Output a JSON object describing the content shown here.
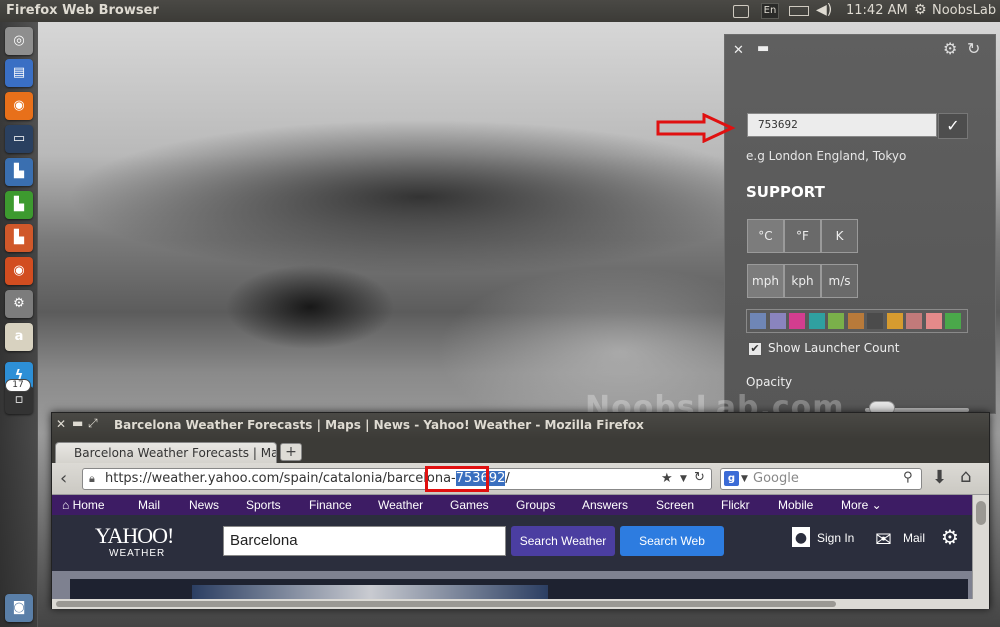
{
  "top_panel": {
    "app_title": "Firefox Web Browser",
    "language": "En",
    "clock": "11:42 AM",
    "user": "NoobsLab"
  },
  "launcher": {
    "items": [
      {
        "name": "dash-icon",
        "glyph": "◎",
        "color": "#8e8e8e"
      },
      {
        "name": "files-icon",
        "glyph": "▤",
        "color": "#3a6fc4"
      },
      {
        "name": "firefox-icon",
        "glyph": "◉",
        "color": "#e8701a"
      },
      {
        "name": "terminal-icon",
        "glyph": "▭",
        "color": "#2a4060"
      },
      {
        "name": "writer-icon",
        "glyph": "▙",
        "color": "#3a6fb0"
      },
      {
        "name": "calc-icon",
        "glyph": "▙",
        "color": "#3d9a2f"
      },
      {
        "name": "impress-icon",
        "glyph": "▙",
        "color": "#d0582a"
      },
      {
        "name": "software-center-icon",
        "glyph": "◉",
        "color": "#d24d20"
      },
      {
        "name": "system-settings-icon",
        "glyph": "⚙",
        "color": "#7c7c7c"
      },
      {
        "name": "amazon-icon",
        "glyph": "a",
        "color": "#d8d2c0"
      },
      {
        "name": "weather-icon",
        "glyph": "ϟ",
        "color": "#2d8fd6"
      },
      {
        "name": "workspace-icon",
        "glyph": "▫",
        "color": "#333333"
      }
    ],
    "badge_count": "17",
    "trash_glyph": "◙"
  },
  "weather_settings": {
    "location_value": "753692",
    "confirm_glyph": "✓",
    "example_text": "e.g London England, Tokyo",
    "support_heading": "SUPPORT",
    "temperature_units": [
      "°C",
      "°F",
      "K"
    ],
    "speed_units": [
      "mph",
      "kph",
      "m/s"
    ],
    "swatches": [
      "#6f86b6",
      "#8a84be",
      "#d33d8f",
      "#2fa0a0",
      "#7ab04a",
      "#b87a3a",
      "#4b4b4b",
      "#d69b2f",
      "#c27a7a",
      "#e48a8a",
      "#4aa84a"
    ],
    "show_launcher_count_label": "Show Launcher Count",
    "opacity_label": "Opacity",
    "opacity_value": 0.05
  },
  "watermark": "NoobsLab.com",
  "firefox": {
    "window_title": "Barcelona Weather Forecasts | Maps | News - Yahoo! Weather - Mozilla Firefox",
    "tab_title": "Barcelona Weather Forecasts | Maps",
    "url_prefix": "https://weather.yahoo.com/spain/catalonia/barcelo",
    "url_mid": "na-",
    "url_highlight": "753692",
    "url_suffix": "/",
    "search_placeholder": "Google"
  },
  "yahoo": {
    "nav_items": [
      {
        "label": "Home"
      },
      {
        "label": "Mail"
      },
      {
        "label": "News"
      },
      {
        "label": "Sports"
      },
      {
        "label": "Finance"
      },
      {
        "label": "Weather"
      },
      {
        "label": "Games"
      },
      {
        "label": "Groups"
      },
      {
        "label": "Answers"
      },
      {
        "label": "Screen"
      },
      {
        "label": "Flickr"
      },
      {
        "label": "Mobile"
      },
      {
        "label": "More"
      }
    ],
    "logo": "YAHOO!",
    "sublogo": "WEATHER",
    "search_value": "Barcelona",
    "search_weather_label": "Search Weather",
    "search_web_label": "Search Web",
    "sign_in_label": "Sign In",
    "mail_label": "Mail"
  }
}
